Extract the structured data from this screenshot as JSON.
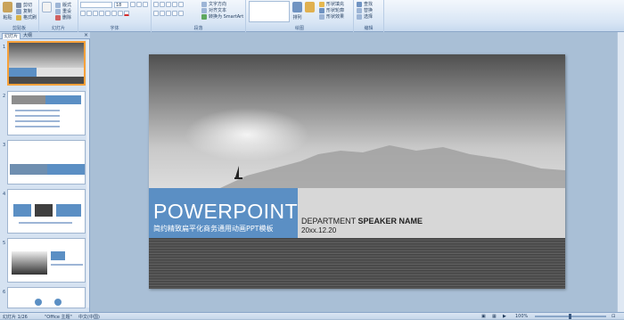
{
  "ribbon": {
    "groups": [
      {
        "label": "剪贴板"
      },
      {
        "label": "幻灯片"
      },
      {
        "label": "字体"
      },
      {
        "label": "段落"
      },
      {
        "label": "绘图"
      },
      {
        "label": "编辑"
      }
    ],
    "clipboard": {
      "paste": "粘贴",
      "cut": "剪切",
      "copy": "复制",
      "format_painter": "格式刷"
    },
    "slides": {
      "new_slide": "新建\n幻灯片",
      "layout": "版式",
      "reset": "重设",
      "delete": "删除"
    },
    "font": {
      "size": "18"
    },
    "paragraph": {
      "text_direction": "文字方向",
      "align_text": "对齐文本",
      "smartart": "转换为 SmartArt"
    },
    "drawing": {
      "arrange": "排列",
      "quick_styles": "快速样式",
      "shape_fill": "形状填充",
      "shape_outline": "形状轮廓",
      "shape_effects": "形状效果"
    },
    "editing": {
      "find": "查找",
      "replace": "替换",
      "select": "选择"
    }
  },
  "panel": {
    "tabs": [
      "幻灯片",
      "大纲"
    ],
    "slide_numbers": [
      "1",
      "2",
      "3",
      "4",
      "5",
      "6"
    ]
  },
  "slide": {
    "title": "POWERPOINT",
    "subtitle": "简约精致扁平化商务通用动画PPT模板",
    "dept_prefix": "DEPARTMENT ",
    "dept_bold": "SPEAKER NAME",
    "date": "20xx.12.20"
  },
  "status": {
    "slide_count": "幻灯片 1/26",
    "theme": "\"Office 主题\"",
    "language": "中文(中国)",
    "zoom": "100%"
  },
  "colors": {
    "accent_blue": "#5b8fc4",
    "selection_orange": "#f7a13a"
  }
}
